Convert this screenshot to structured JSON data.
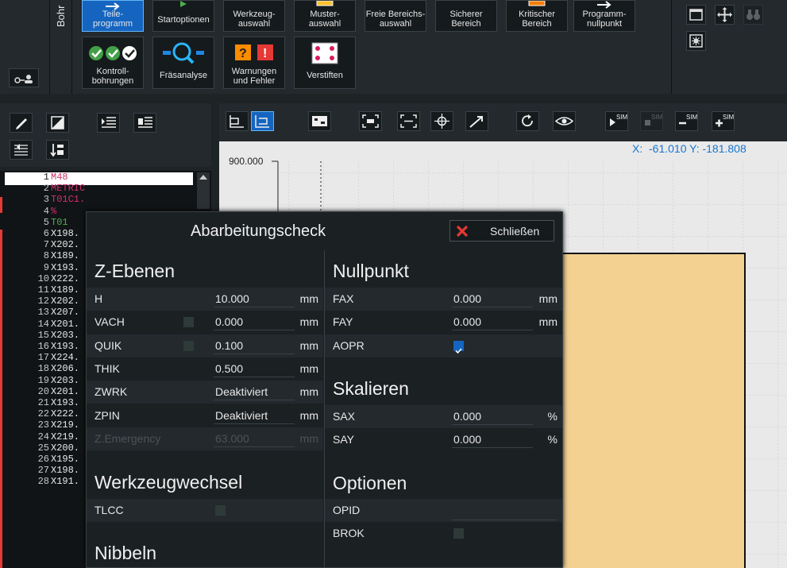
{
  "ribbon": {
    "group_label": "Bohr",
    "buttons": [
      {
        "label1": "Teile-",
        "label2": "programm"
      },
      {
        "label1": "Startoptionen",
        "label2": ""
      },
      {
        "label1": "Werkzeug-",
        "label2": "auswahl"
      },
      {
        "label1": "Muster-",
        "label2": "auswahl"
      },
      {
        "label1": "Freie Bereichs-",
        "label2": "auswahl"
      },
      {
        "label1": "Sicherer",
        "label2": "Bereich"
      },
      {
        "label1": "Kritischer",
        "label2": "Bereich"
      },
      {
        "label1": "Programm-",
        "label2": "nullpunkt"
      },
      {
        "label1": "Kontroll-",
        "label2": "bohrungen"
      },
      {
        "label1": "Fräsanalyse",
        "label2": ""
      },
      {
        "label1": "Warnungen",
        "label2": "und Fehler"
      },
      {
        "label1": "Verstiften",
        "label2": ""
      }
    ]
  },
  "coords": "X:  -61.010 Y: -181.808",
  "axis_label": "900.000",
  "sim_label": "SIM",
  "code_lines": [
    {
      "n": "1",
      "t": "M48",
      "c": "#d0316c"
    },
    {
      "n": "2",
      "t": "METRIC",
      "c": "#d0316c"
    },
    {
      "n": "3",
      "t": "T01C1.",
      "c": "#d0316c"
    },
    {
      "n": "4",
      "t": "%",
      "c": "#d0316c"
    },
    {
      "n": "5",
      "t": "T01",
      "c": "#4caf50"
    },
    {
      "n": "6",
      "t": "X198.",
      "c": "#e8e8e8"
    },
    {
      "n": "7",
      "t": "X202.",
      "c": "#e8e8e8"
    },
    {
      "n": "8",
      "t": "X189.",
      "c": "#e8e8e8"
    },
    {
      "n": "9",
      "t": "X193.",
      "c": "#e8e8e8"
    },
    {
      "n": "10",
      "t": "X222.",
      "c": "#e8e8e8"
    },
    {
      "n": "11",
      "t": "X189.",
      "c": "#e8e8e8"
    },
    {
      "n": "12",
      "t": "X202.",
      "c": "#e8e8e8"
    },
    {
      "n": "13",
      "t": "X207.",
      "c": "#e8e8e8"
    },
    {
      "n": "14",
      "t": "X201.",
      "c": "#e8e8e8"
    },
    {
      "n": "15",
      "t": "X203.",
      "c": "#e8e8e8"
    },
    {
      "n": "16",
      "t": "X193.",
      "c": "#e8e8e8"
    },
    {
      "n": "17",
      "t": "X224.",
      "c": "#e8e8e8"
    },
    {
      "n": "18",
      "t": "X206.",
      "c": "#e8e8e8"
    },
    {
      "n": "19",
      "t": "X203.",
      "c": "#e8e8e8"
    },
    {
      "n": "20",
      "t": "X201.",
      "c": "#e8e8e8"
    },
    {
      "n": "21",
      "t": "X193.",
      "c": "#e8e8e8"
    },
    {
      "n": "22",
      "t": "X222.",
      "c": "#e8e8e8"
    },
    {
      "n": "23",
      "t": "X219.",
      "c": "#e8e8e8"
    },
    {
      "n": "24",
      "t": "X219.",
      "c": "#e8e8e8"
    },
    {
      "n": "25",
      "t": "X200.",
      "c": "#e8e8e8"
    },
    {
      "n": "26",
      "t": "X195.",
      "c": "#e8e8e8"
    },
    {
      "n": "27",
      "t": "X198.",
      "c": "#e8e8e8"
    },
    {
      "n": "28",
      "t": "X191.",
      "c": "#e8e8e8"
    }
  ],
  "dialog": {
    "title": "Abarbeitungscheck",
    "close_label": "Schließen",
    "z_title": "Z-Ebenen",
    "z_rows": [
      {
        "label": "H",
        "value": "10.000",
        "unit": "mm"
      },
      {
        "label": "VACH",
        "value": "0.000",
        "unit": "mm"
      },
      {
        "label": "QUIK",
        "value": "0.100",
        "unit": "mm"
      },
      {
        "label": "THIK",
        "value": "0.500",
        "unit": "mm"
      },
      {
        "label": "ZWRK",
        "value": "Deaktiviert",
        "unit": "mm"
      },
      {
        "label": "ZPIN",
        "value": "Deaktiviert",
        "unit": "mm"
      },
      {
        "label": "Z.Emergency",
        "value": "63.000",
        "unit": "mm"
      }
    ],
    "tool_title": "Werkzeugwechsel",
    "tlcc_label": "TLCC",
    "nib_title": "Nibbeln",
    "null_title": "Nullpunkt",
    "null_rows": [
      {
        "label": "FAX",
        "value": "0.000",
        "unit": "mm"
      },
      {
        "label": "FAY",
        "value": "0.000",
        "unit": "mm"
      },
      {
        "label": "AOPR",
        "value": "",
        "unit": ""
      }
    ],
    "scale_title": "Skalieren",
    "scale_rows": [
      {
        "label": "SAX",
        "value": "0.000",
        "unit": "%"
      },
      {
        "label": "SAY",
        "value": "0.000",
        "unit": "%"
      }
    ],
    "opt_title": "Optionen",
    "opt_rows": [
      {
        "label": "OPID"
      },
      {
        "label": "BROK"
      }
    ]
  }
}
